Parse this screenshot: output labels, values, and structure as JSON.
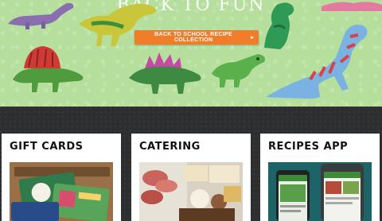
{
  "hero": {
    "title": "BACK TO FUN",
    "cta_label": "BACK TO SCHOOL RECIPE COLLECTION",
    "cta_arrow": "▸"
  },
  "cards": [
    {
      "title": "GIFT CARDS",
      "icon": "gift-cards-photo"
    },
    {
      "title": "CATERING",
      "icon": "catering-platter-photo"
    },
    {
      "title": "RECIPES APP",
      "icon": "phone-app-photo"
    }
  ],
  "colors": {
    "hero_bg": "#b6df9e",
    "cta_bg": "#f07d2a",
    "dark_bg": "#2d2e2f",
    "card_bg": "#ffffff"
  }
}
